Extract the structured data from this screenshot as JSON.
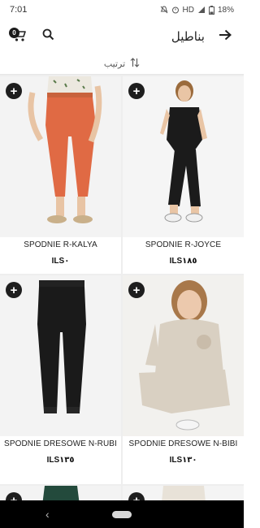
{
  "status": {
    "time": "7:01",
    "network": "HD",
    "battery": "18%"
  },
  "header": {
    "cart_count": "0",
    "title": "بناطيل"
  },
  "sort": {
    "label": "ترتيب"
  },
  "products": [
    {
      "name": "SPODNIE R-KALYA",
      "price": "ILS٠"
    },
    {
      "name": "SPODNIE R-JOYCE",
      "price": "ILS١٨٥"
    },
    {
      "name": "SPODNIE DRESOWE N-RUBI",
      "price": "ILS١٣٥"
    },
    {
      "name": "SPODNIE DRESOWE N-BIBI",
      "price": "ILS١٣٠"
    }
  ],
  "colors": {
    "accent": "#1e1e1e",
    "orange_pants": "#e06a44",
    "black_pants": "#1a1a1a",
    "beige_set": "#d9d0c2"
  }
}
